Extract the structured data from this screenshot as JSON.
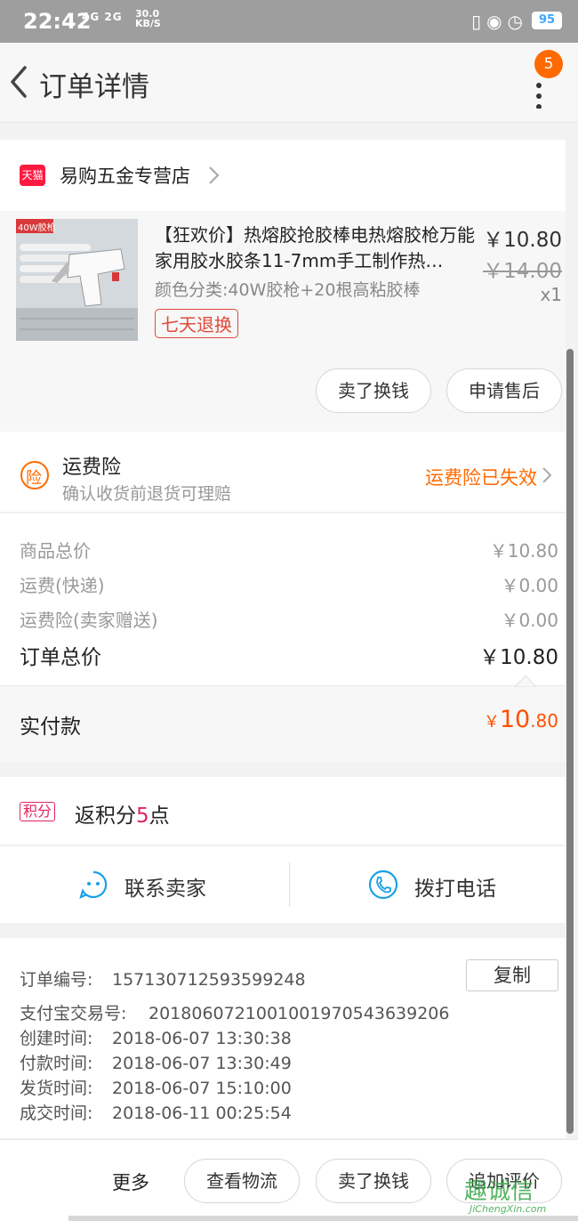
{
  "status_bar": {
    "time": "22:42",
    "network": "4G 2G",
    "speed_value": "30.0",
    "speed_unit": "KB/S",
    "battery": "95",
    "icons": [
      "vibrate-icon",
      "lock-icon",
      "alarm-icon"
    ]
  },
  "nav": {
    "title": "订单详情",
    "badge_count": "5"
  },
  "shop": {
    "badge": "天猫",
    "name": "易购五金专营店"
  },
  "product": {
    "title": "【狂欢价】热熔胶抢胶棒电热熔胶枪万能家用胶水胶条11-7mm手工制作热…",
    "spec": "颜色分类:40W胶枪+20根高粘胶棒",
    "service_tag": "七天退换",
    "price": "￥10.80",
    "original_price": "￥14.00",
    "quantity": "x1",
    "image_label": "40W胶枪",
    "actions": [
      "卖了换钱",
      "申请售后"
    ]
  },
  "insurance": {
    "icon_char": "险",
    "title": "运费险",
    "subtitle": "确认收货前退货可理赔",
    "status": "运费险已失效"
  },
  "summary": {
    "rows": [
      {
        "label": "商品总价",
        "value": "￥10.80"
      },
      {
        "label": "运费(快递)",
        "value": "￥0.00"
      },
      {
        "label": "运费险(卖家赠送)",
        "value": "￥0.00"
      }
    ],
    "total_label": "订单总价",
    "total_value": "￥10.80"
  },
  "payment": {
    "label": "实付款",
    "currency": "￥",
    "integer": "10",
    "decimal": ".80"
  },
  "points": {
    "tag": "积分",
    "prefix": "返积分",
    "count": "5",
    "suffix": "点"
  },
  "contact": {
    "seller_label": "联系卖家",
    "phone_label": "拨打电话"
  },
  "order_info": {
    "copy_label": "复制",
    "rows": [
      {
        "label": "订单编号:",
        "value": "157130712593599248"
      },
      {
        "label": "支付宝交易号:",
        "value": "2018060721001001970543639206"
      },
      {
        "label": "创建时间:",
        "value": "2018-06-07 13:30:38"
      },
      {
        "label": "付款时间:",
        "value": "2018-06-07 13:30:49"
      },
      {
        "label": "发货时间:",
        "value": "2018-06-07 15:10:00"
      },
      {
        "label": "成交时间:",
        "value": "2018-06-11 00:25:54"
      }
    ]
  },
  "bottom_bar": {
    "more": "更多",
    "buttons": [
      "查看物流",
      "卖了换钱",
      "追加评价"
    ]
  },
  "watermark": {
    "text": "趣诚信",
    "url": "JiChengXin.com"
  },
  "colors": {
    "accent_orange": "#ff6a00",
    "price_red": "#ff5000",
    "tmall_red": "#ff1a40",
    "icon_blue": "#1aa0e6"
  }
}
